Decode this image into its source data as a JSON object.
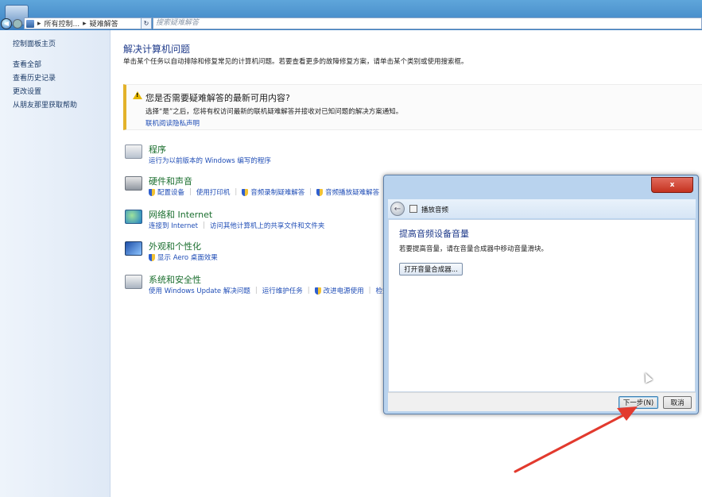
{
  "address_bar": {
    "breadcrumb_1": "所有控制...",
    "breadcrumb_2": "疑难解答",
    "refresh": "↻",
    "search_placeholder": "搜索疑难解答"
  },
  "sidebar": {
    "home": "控制面板主页",
    "items": [
      {
        "label": "查看全部"
      },
      {
        "label": "查看历史记录"
      },
      {
        "label": "更改设置"
      },
      {
        "label": "从朋友那里获取帮助"
      }
    ]
  },
  "main": {
    "title": "解决计算机问题",
    "description": "单击某个任务以自动排除和修复常见的计算机问题。若要查看更多的故障修复方案，请单击某个类别或使用搜索框。",
    "notice": {
      "title": "您是否需要疑难解答的最新可用内容?",
      "body": "选择“是”之后，您将有权访问最新的联机疑难解答并接收对已知问题的解决方案通知。",
      "link": "联机阅读隐私声明"
    },
    "categories": [
      {
        "title": "程序",
        "links": [
          "运行为以前版本的 Windows 编写的程序"
        ]
      },
      {
        "title": "硬件和声音",
        "links": [
          "配置设备",
          "使用打印机",
          "音频录制疑难解答",
          "音频播放疑难解答"
        ]
      },
      {
        "title": "网络和 Internet",
        "links": [
          "连接到 Internet",
          "访问其他计算机上的共享文件和文件夹"
        ]
      },
      {
        "title": "外观和个性化",
        "links": [
          "显示 Aero 桌面效果"
        ]
      },
      {
        "title": "系统和安全性",
        "links": [
          "使用 Windows Update 解决问题",
          "运行维护任务",
          "改进电源使用",
          "检查"
        ]
      }
    ]
  },
  "dialog": {
    "close": "x",
    "back": "←",
    "name": "播放音频",
    "title": "提高音频设备音量",
    "description": "若要提高音量，请在音量合成器中移动音量滑块。",
    "mixer_button": "打开音量合成器...",
    "next_button": "下一步(N)",
    "cancel_button": "取消"
  },
  "colors": {
    "accent_link": "#1f4db6",
    "category_title": "#1a6e2e",
    "warning": "#e3b22a",
    "close_red": "#c4321f",
    "annotation_arrow": "#e23a2e"
  }
}
